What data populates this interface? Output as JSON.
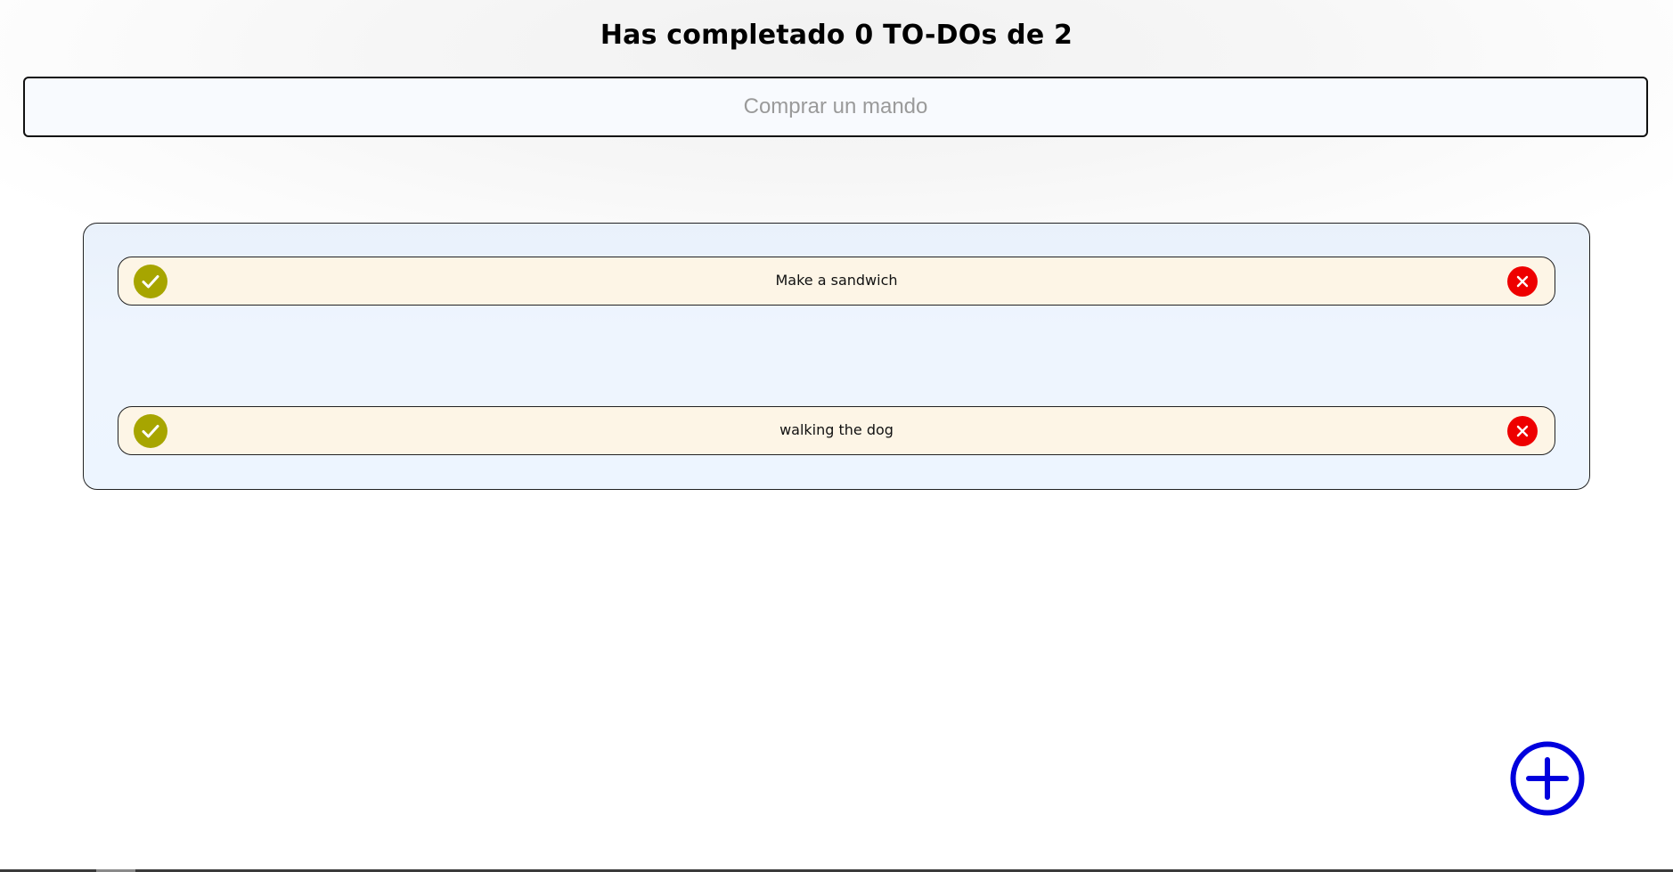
{
  "header": {
    "title": "Has completado 0 TO-DOs de 2"
  },
  "new_todo": {
    "placeholder": "Comprar un mando",
    "value": ""
  },
  "todos": [
    {
      "text": "Make a sandwich",
      "completed": false
    },
    {
      "text": "walking the dog",
      "completed": false
    }
  ],
  "icons": {
    "complete": "check-circle-icon",
    "delete": "x-circle-icon",
    "add": "plus-circle-icon"
  },
  "colors": {
    "complete_button": "#a7a500",
    "delete_button": "#ee0000",
    "add_button": "#0000dd",
    "todo_background": "#fdf5e6",
    "list_background": "#edf5ff"
  }
}
